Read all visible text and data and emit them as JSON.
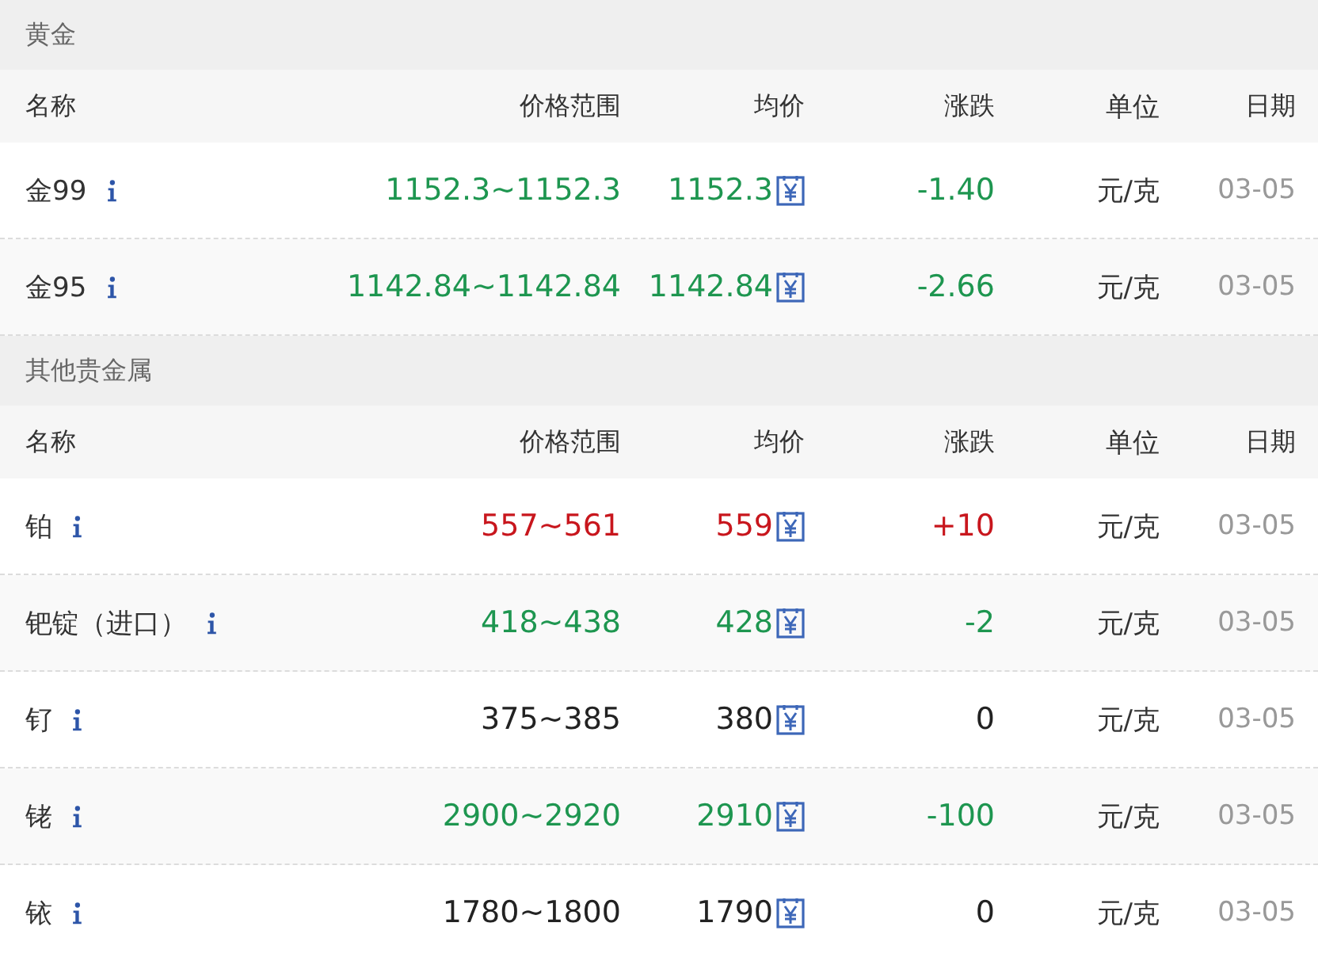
{
  "sections": [
    {
      "title": "黄金",
      "columns": [
        "名称",
        "价格范围",
        "均价",
        "涨跌",
        "单位",
        "日期"
      ],
      "rows": [
        {
          "name": "金99",
          "price_range": "1152.3~1152.3",
          "average": "1152.3",
          "change": "-1.40",
          "color": "#1e9650",
          "unit": "元/克",
          "date": "03-05"
        },
        {
          "name": "金95",
          "price_range": "1142.84~1142.84",
          "average": "1142.84",
          "change": "-2.66",
          "color": "#1e9650",
          "unit": "元/克",
          "date": "03-05"
        }
      ]
    },
    {
      "title": "其他贵金属",
      "columns": [
        "名称",
        "价格范围",
        "均价",
        "涨跌",
        "单位",
        "日期"
      ],
      "rows": [
        {
          "name": "铂",
          "price_range": "557~561",
          "average": "559",
          "change": "+10",
          "color": "#c8161d",
          "unit": "元/克",
          "date": "03-05"
        },
        {
          "name": "钯锭（进口）",
          "price_range": "418~438",
          "average": "428",
          "change": "-2",
          "color": "#1e9650",
          "unit": "元/克",
          "date": "03-05"
        },
        {
          "name": "钌",
          "price_range": "375~385",
          "average": "380",
          "change": "0",
          "color": "#222222",
          "unit": "元/克",
          "date": "03-05"
        },
        {
          "name": "铑",
          "price_range": "2900~2920",
          "average": "2910",
          "change": "-100",
          "color": "#1e9650",
          "unit": "元/克",
          "date": "03-05"
        },
        {
          "name": "铱",
          "price_range": "1780~1800",
          "average": "1790",
          "change": "0",
          "color": "#222222",
          "unit": "元/克",
          "date": "03-05"
        }
      ]
    }
  ]
}
